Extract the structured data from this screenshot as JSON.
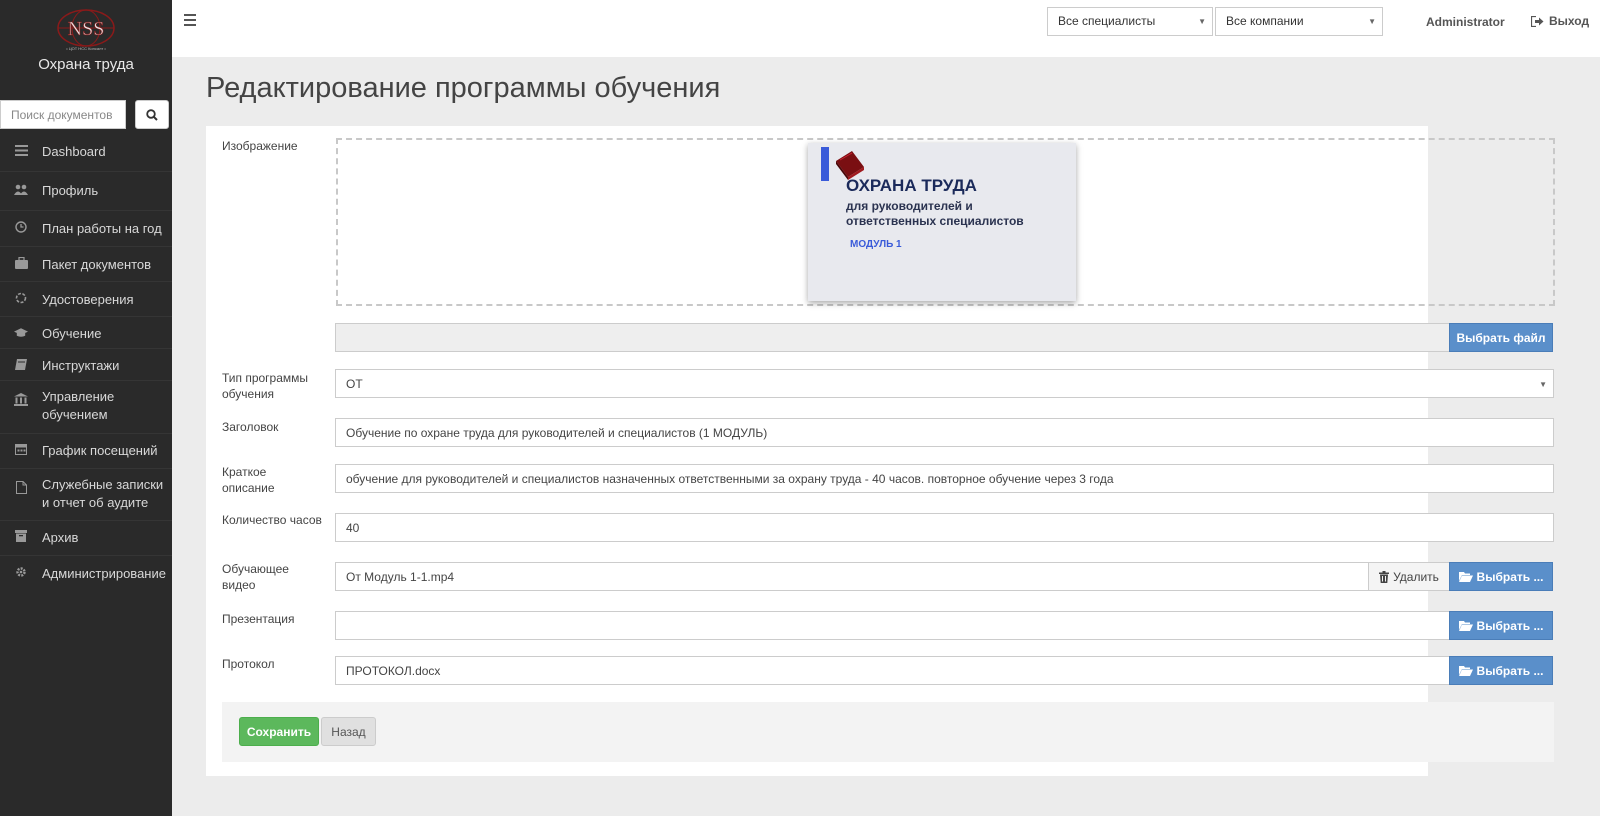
{
  "sidebar": {
    "logo_text": "NSS",
    "logo_subtext": "• ЦОТ НСС Консалт •",
    "brand": "Охрана труда",
    "search_placeholder": "Поиск документов",
    "items": [
      {
        "label": "Dashboard",
        "icon": "list-icon"
      },
      {
        "label": "Профиль",
        "icon": "users-icon"
      },
      {
        "label": "План работы на год",
        "icon": "clock-icon"
      },
      {
        "label": "Пакет документов",
        "icon": "briefcase-icon"
      },
      {
        "label": "Удостоверения",
        "icon": "circle-icon"
      },
      {
        "label": "Обучение",
        "icon": "graduation-cap-icon"
      },
      {
        "label": "Инструктажи",
        "icon": "book-icon"
      },
      {
        "label": "Управление обучением",
        "icon": "bank-icon"
      },
      {
        "label": "График посещений",
        "icon": "calendar-icon"
      },
      {
        "label": "Служебные записки и отчет об аудите",
        "icon": "file-icon"
      },
      {
        "label": "Архив",
        "icon": "archive-icon"
      },
      {
        "label": "Администрирование",
        "icon": "gear-icon"
      }
    ]
  },
  "topbar": {
    "specialists_select": "Все специалисты",
    "companies_select": "Все компании",
    "user": "Administrator",
    "logout": "Выход"
  },
  "page": {
    "title": "Редактирование программы обучения"
  },
  "form": {
    "image_label": "Изображение",
    "cover": {
      "title": "ОХРАНА ТРУДА",
      "subtitle": "для руководителей и ответственных специалистов",
      "module": "МОДУЛЬ 1"
    },
    "image_file_value": "",
    "choose_file_label": "Выбрать файл",
    "type_label": "Тип программы обучения",
    "type_value": "ОТ",
    "heading_label": "Заголовок",
    "heading_value": "Обучение по охране труда для руководителей и специалистов (1 МОДУЛЬ)",
    "short_desc_label": "Краткое описание",
    "short_desc_value": "обучение для руководителей и специалистов назначенных ответственными за охрану труда - 40 часов. повторное обучение через 3 года",
    "hours_label": "Количество часов",
    "hours_value": "40",
    "video_label": "Обучающее видео",
    "video_value": "От Модуль 1-1.mp4",
    "delete_label": "Удалить",
    "choose_label": "Выбрать ...",
    "presentation_label": "Презентация",
    "presentation_value": "",
    "protocol_label": "Протокол",
    "protocol_value": "ПРОТОКОЛ.docx",
    "save_label": "Сохранить",
    "back_label": "Назад"
  },
  "colors": {
    "sidebar_bg": "#2a2a2a",
    "primary_blue": "#5a8fca",
    "save_green": "#5cb85c",
    "page_bg": "#ececec"
  }
}
